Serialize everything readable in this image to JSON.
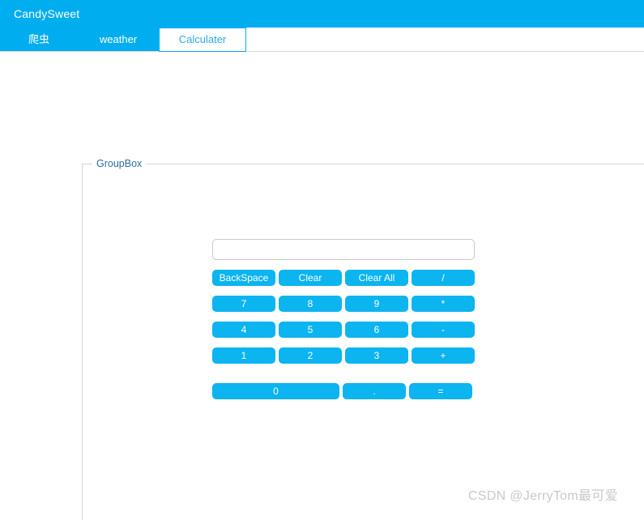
{
  "header": {
    "title": "CandySweet",
    "bg_color": "#00AEEF"
  },
  "tabs": [
    {
      "label": "爬虫",
      "active": false
    },
    {
      "label": "weather",
      "active": false
    },
    {
      "label": "Calculater",
      "active": true
    }
  ],
  "groupbox": {
    "label": "GroupBox",
    "label_color": "#2B6F9B"
  },
  "calculator": {
    "display": {
      "value": "",
      "placeholder": ""
    },
    "button_color": "#0CB4F0",
    "rows": [
      {
        "keys": [
          {
            "label": "BackSpace",
            "size": "std"
          },
          {
            "label": "Clear",
            "size": "std"
          },
          {
            "label": "Clear All",
            "size": "std"
          },
          {
            "label": "/",
            "size": "std"
          }
        ]
      },
      {
        "keys": [
          {
            "label": "7",
            "size": "std"
          },
          {
            "label": "8",
            "size": "std"
          },
          {
            "label": "9",
            "size": "std"
          },
          {
            "label": "*",
            "size": "std"
          }
        ]
      },
      {
        "keys": [
          {
            "label": "4",
            "size": "std"
          },
          {
            "label": "5",
            "size": "std"
          },
          {
            "label": "6",
            "size": "std"
          },
          {
            "label": "-",
            "size": "std"
          }
        ]
      },
      {
        "keys": [
          {
            "label": "1",
            "size": "std"
          },
          {
            "label": "2",
            "size": "std"
          },
          {
            "label": "3",
            "size": "std"
          },
          {
            "label": "+",
            "size": "std"
          }
        ]
      },
      {
        "keys": [
          {
            "label": "0",
            "size": "wide"
          },
          {
            "label": ".",
            "size": "std"
          },
          {
            "label": "=",
            "size": "std"
          }
        ]
      }
    ]
  },
  "watermark": {
    "text": "CSDN @JerryTom最可爱"
  }
}
